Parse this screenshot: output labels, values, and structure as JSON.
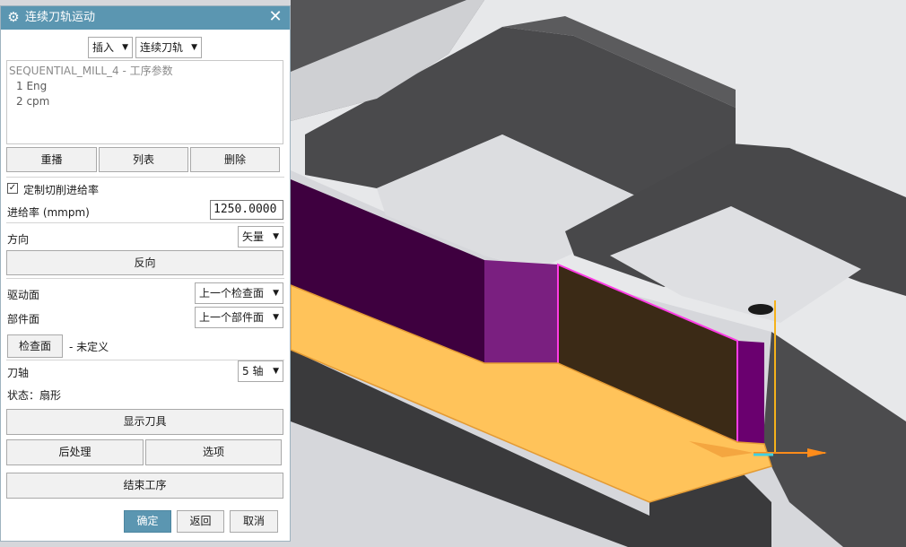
{
  "window": {
    "title": "连续刀轨运动",
    "close_glyph": "✕"
  },
  "toolbar": {
    "insert_label": "插入",
    "mode_label": "连续刀轨"
  },
  "history": {
    "header": "SEQUENTIAL_MILL_4 - 工序参数",
    "items": [
      "1  Eng",
      "2  cpm"
    ]
  },
  "history_buttons": {
    "replay": "重播",
    "list": "列表",
    "delete": "删除"
  },
  "feed": {
    "custom_label": "定制切削进给率",
    "custom_checked": true,
    "rate_label": "进给率 (mmpm)",
    "rate_value": "1250.0000"
  },
  "direction": {
    "label": "方向",
    "value": "矢量",
    "reverse_button": "反向"
  },
  "surfaces": {
    "drive_label": "驱动面",
    "drive_value": "上一个检查面",
    "part_label": "部件面",
    "part_value": "上一个部件面",
    "check_button": "检查面",
    "check_status": "- 未定义"
  },
  "tool_axis": {
    "label": "刀轴",
    "value": "5 轴",
    "status": "状态：扇形"
  },
  "actions": {
    "show_tool": "显示刀具",
    "post": "后处理",
    "options": "选项",
    "end": "结束工序"
  },
  "footer": {
    "ok": "确定",
    "back": "返回",
    "cancel": "取消"
  },
  "colors": {
    "titlebar": "#5b96b1",
    "floor": "#ffc35a",
    "wall": "#6a006f",
    "check_face": "#3b2a16",
    "highlight": "#ff3ce6",
    "axis_z": "#f5b21b",
    "axis_x": "#ff8c1a",
    "axis_y": "#40d0e0"
  },
  "icons": {
    "title": "gear-icon",
    "close": "close-icon",
    "dropdown": "triangle-down-icon",
    "checkbox": "check-icon"
  }
}
